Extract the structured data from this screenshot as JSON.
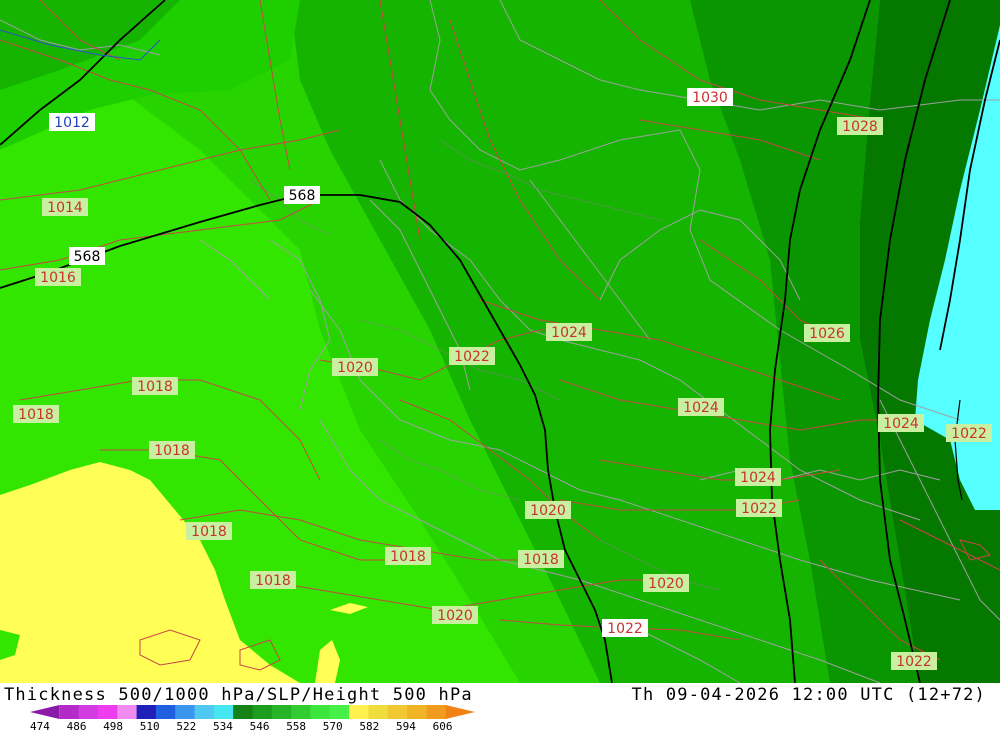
{
  "footer": {
    "title_left": "Thickness 500/1000 hPa/SLP/Height 500 hPa",
    "title_right": "Th 09-04-2026 12:00 UTC (12+72)"
  },
  "legend": {
    "ticks": [
      "474",
      "486",
      "498",
      "510",
      "522",
      "534",
      "546",
      "558",
      "570",
      "582",
      "594",
      "606"
    ],
    "colors": [
      "#8a1aa8",
      "#b42cc8",
      "#d23ce2",
      "#ee3cf0",
      "#f08cf0",
      "#2020b8",
      "#2060e0",
      "#3c96f0",
      "#50c8f0",
      "#46e6f0",
      "#148214",
      "#1e9c1e",
      "#28b428",
      "#32cc32",
      "#3ce63c",
      "#46f046",
      "#fff050",
      "#f0dc3c",
      "#f0c832",
      "#f0b428",
      "#f09c1e",
      "#f08214"
    ]
  },
  "map": {
    "colors": {
      "yellow": "#ffff55",
      "green_light": "#32e600",
      "green_mid": "#1ecf00",
      "green_darker": "#14b400",
      "green_dark": "#0a9600",
      "green_deep": "#057800",
      "cyan": "#55ffff",
      "isobar": "#c84646",
      "border": "#a0a0a0",
      "height_line": "#000000"
    },
    "height_labels": [
      "568",
      "568"
    ],
    "pressure_labels": [
      "1012",
      "1014",
      "1016",
      "1018",
      "1018",
      "1018",
      "1018",
      "1018",
      "1018",
      "1018",
      "1018",
      "1020",
      "1020",
      "1020",
      "1020",
      "1022",
      "1022",
      "1022",
      "1022",
      "1022",
      "1024",
      "1024",
      "1024",
      "1024",
      "1026",
      "1028",
      "1030"
    ]
  }
}
